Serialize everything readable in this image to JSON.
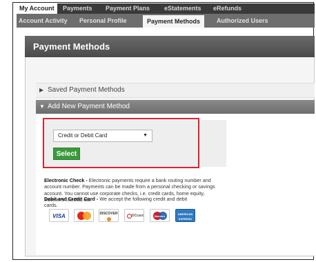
{
  "top_nav": {
    "tabs": [
      "My Account",
      "Payments",
      "Payment Plans",
      "eStatements",
      "eRefunds"
    ],
    "active": "My Account"
  },
  "sub_nav": {
    "tabs": [
      "Account Activity",
      "Personal Profile",
      "Payment Methods",
      "Authorized Users"
    ],
    "active": "Payment Methods"
  },
  "panel": {
    "title": "Payment Methods",
    "sections": {
      "saved": {
        "label": "Saved Payment Methods",
        "icon": "triangle-right-icon"
      },
      "add_new": {
        "label": "Add New Payment Method",
        "icon": "triangle-down-icon"
      }
    }
  },
  "method_select": {
    "selected": "Credit or Debit Card",
    "button_label": "Select"
  },
  "info": {
    "echeck_title": "Electronic Check -",
    "echeck_text": "Electronic payments require a bank routing number and account number. Payments can be made from a personal checking or savings account. You cannot use corporate checks, i.e. credit cards, home equity, traveler's checks, etc.",
    "card_title": "Debit and Credit Card -",
    "card_text": "We accept the following credit and debit cards."
  },
  "accepted_cards": {
    "visa": "VISA",
    "mastercard": "MasterCard",
    "discover": "DISCOVER",
    "diners": "DCcard",
    "maestro": "Maestro",
    "amex": "AMERICAN EXPRESS"
  },
  "colors": {
    "top_nav_bg": "#3a3a3a",
    "sub_nav_bg": "#6e6e6e",
    "panel_header_bg": "#555555",
    "select_button": "#3a9a3a",
    "highlight_border": "#e0202b"
  }
}
